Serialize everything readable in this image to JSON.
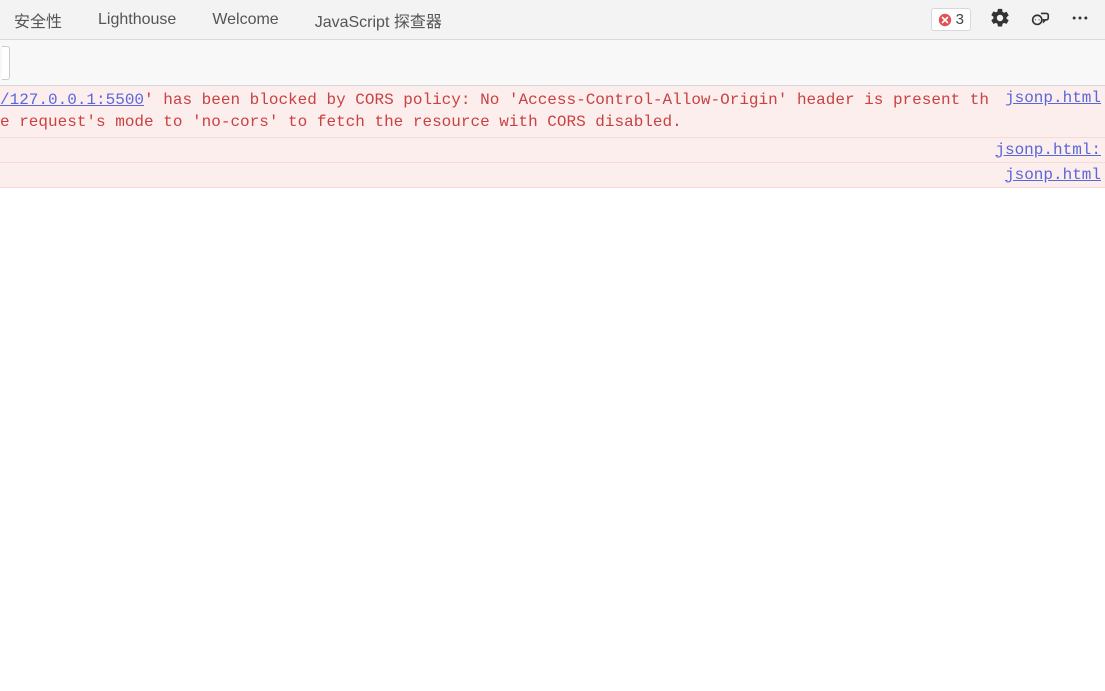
{
  "tabs": [
    "安全性",
    "Lighthouse",
    "Welcome",
    "JavaScript 探查器"
  ],
  "errorCount": "3",
  "console": {
    "rows": [
      {
        "origin": "/127.0.0.1:5500",
        "rest": "' has been blocked by CORS policy: No 'Access-Control-Allow-Origin' header is present the request's mode to 'no-cors' to fetch the resource with CORS disabled.",
        "source": "jsonp.html"
      },
      {
        "origin": "",
        "rest": "",
        "source": "jsonp.html:"
      },
      {
        "origin": "",
        "rest": "",
        "source": "jsonp.html"
      }
    ]
  }
}
